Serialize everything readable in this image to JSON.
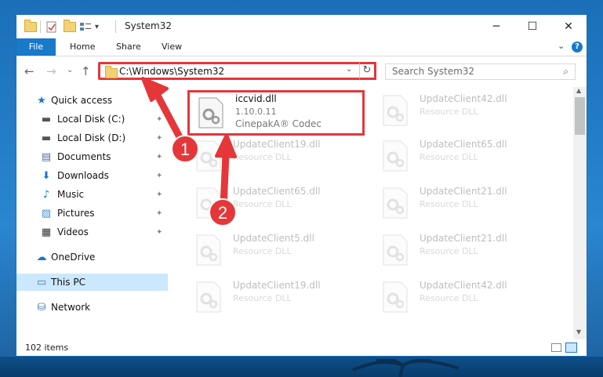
{
  "window": {
    "title": "System32",
    "minimize_glyph": "─",
    "maximize_glyph": "☐",
    "close_glyph": "✕"
  },
  "ribbon": {
    "tabs": [
      "File",
      "Home",
      "Share",
      "View"
    ],
    "help_glyph": "?",
    "collapse_glyph": "⌄"
  },
  "address": {
    "path": "C:\\Windows\\System32",
    "dropdown_glyph": "⌄",
    "refresh_glyph": "↻"
  },
  "nav_buttons": {
    "back": "←",
    "forward": "→",
    "recent": "⌄",
    "up": "↑"
  },
  "search": {
    "placeholder": "Search System32",
    "icon": "search-icon"
  },
  "nav_pane": {
    "items": [
      {
        "label": "Quick access",
        "icon": "star-icon",
        "glyph": "★"
      },
      {
        "label": "Local Disk (C:)",
        "icon": "drive-icon",
        "glyph": "▬"
      },
      {
        "label": "Local Disk (D:)",
        "icon": "drive-icon",
        "glyph": "▬"
      },
      {
        "label": "Documents",
        "icon": "document-icon",
        "glyph": "▤"
      },
      {
        "label": "Downloads",
        "icon": "download-icon",
        "glyph": "⬇"
      },
      {
        "label": "Music",
        "icon": "music-icon",
        "glyph": "♪"
      },
      {
        "label": "Pictures",
        "icon": "pictures-icon",
        "glyph": "▨"
      },
      {
        "label": "Videos",
        "icon": "video-icon",
        "glyph": "▦"
      },
      {
        "label": "OneDrive",
        "icon": "cloud-icon",
        "glyph": "☁"
      },
      {
        "label": "This PC",
        "icon": "computer-icon",
        "glyph": "▭"
      },
      {
        "label": "Network",
        "icon": "network-icon",
        "glyph": "⛁"
      }
    ],
    "pin_glyph": "📌"
  },
  "files": {
    "selected": {
      "name": "iccvid.dll",
      "version": "1.10.0.11",
      "description": "CinepakA® Codec"
    },
    "left_column": [
      {
        "name": "UpdateClient19.dll",
        "type": "Resource DLL"
      },
      {
        "name": "UpdateClient65.dll",
        "type": "Resource DLL"
      },
      {
        "name": "UpdateClient5.dll",
        "type": "Resource DLL"
      },
      {
        "name": "UpdateClient19.dll",
        "type": "Resource DLL"
      }
    ],
    "right_column": [
      {
        "name": "UpdateClient42.dll",
        "type": "Resource DLL"
      },
      {
        "name": "UpdateClient65.dll",
        "type": "Resource DLL"
      },
      {
        "name": "UpdateClient21.dll",
        "type": "Resource DLL"
      },
      {
        "name": "UpdateClient21.dll",
        "type": "Resource DLL"
      },
      {
        "name": "UpdateClient42.dll",
        "type": "Resource DLL"
      }
    ]
  },
  "status": {
    "item_count": "102 items"
  },
  "annotations": {
    "step1": "1",
    "step2": "2",
    "color": "#e5363a"
  }
}
